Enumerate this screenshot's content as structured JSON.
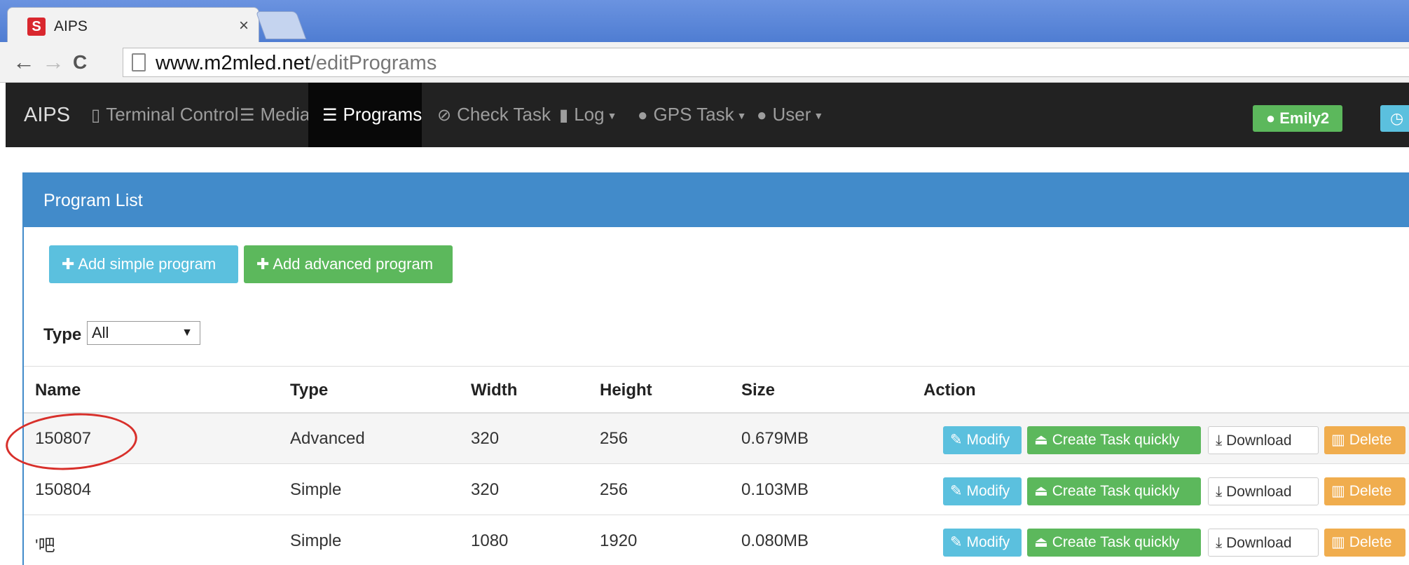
{
  "browser": {
    "tab_title": "AIPS",
    "tab_close": "×",
    "favicon_text": "S",
    "url_host": "www.m2mled.net",
    "url_path": "/editPrograms",
    "back": "←",
    "forward": "→",
    "reload": "C"
  },
  "navbar": {
    "brand": "AIPS",
    "items": [
      {
        "label": "Terminal Control",
        "icon": "mobile-icon"
      },
      {
        "label": "Media",
        "icon": "server-icon"
      },
      {
        "label": "Programs",
        "icon": "list-icon",
        "active": true
      },
      {
        "label": "Check Task",
        "icon": "check-circle-icon"
      },
      {
        "label": "Log",
        "icon": "file-icon"
      },
      {
        "label": "GPS Task",
        "icon": "globe-icon"
      },
      {
        "label": "User",
        "icon": "user-icon"
      }
    ],
    "user_name": "Emily2"
  },
  "panel": {
    "title": "Program List",
    "add_simple": "Add simple program",
    "add_advanced": "Add advanced program",
    "type_label": "Type",
    "type_selected": "All"
  },
  "table": {
    "headers": [
      "Name",
      "Type",
      "Width",
      "Height",
      "Size",
      "Action"
    ],
    "rows": [
      {
        "name": "150807",
        "type": "Advanced",
        "width": "320",
        "height": "256",
        "size": "0.679MB"
      },
      {
        "name": "150804",
        "type": "Simple",
        "width": "320",
        "height": "256",
        "size": "0.103MB"
      },
      {
        "name": "'吧",
        "type": "Simple",
        "width": "1080",
        "height": "1920",
        "size": "0.080MB"
      }
    ],
    "actions": {
      "modify": "Modify",
      "create": "Create Task quickly",
      "download": "Download",
      "delete": "Delete"
    }
  },
  "colors": {
    "primary": "#428bca",
    "info": "#5bc0de",
    "success": "#5cb85c",
    "warning": "#f0ad4e",
    "navbar": "#222222",
    "annotation": "#d8302b"
  }
}
